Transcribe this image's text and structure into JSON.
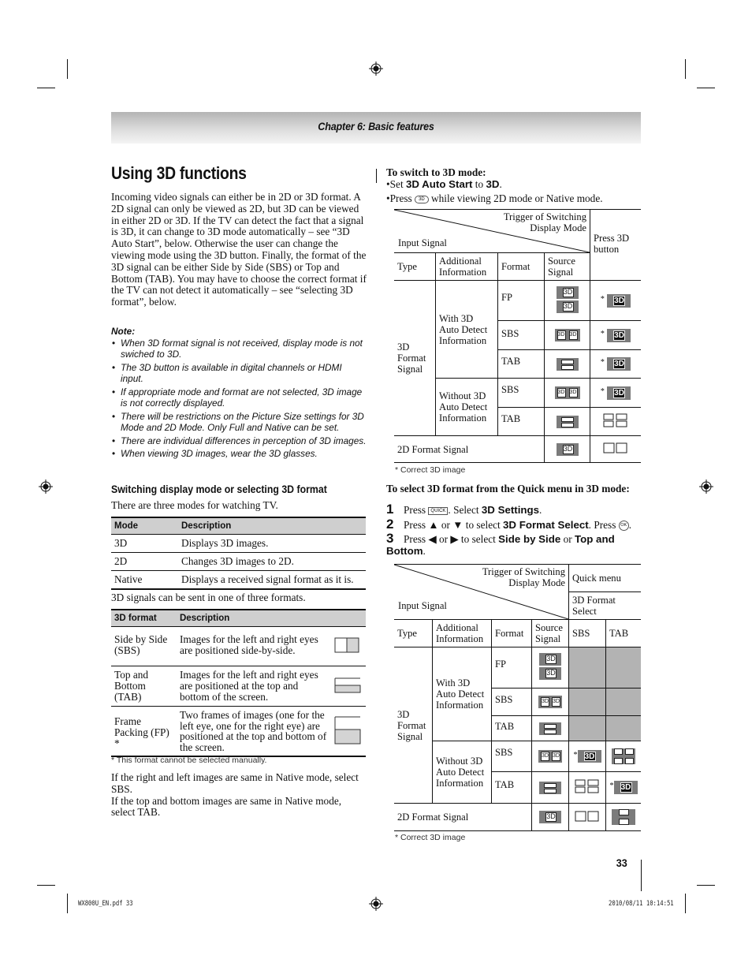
{
  "header": {
    "chapter": "Chapter 6: Basic features"
  },
  "title": "Using 3D functions",
  "intro": "Incoming video signals can either be in 2D or 3D format. A 2D signal can only be viewed as 2D, but 3D can be viewed in either 2D or 3D. If the TV can detect the fact that a signal is 3D, it can change to 3D mode automatically – see “3D Auto Start”, below. Otherwise the user can change the viewing mode using the 3D button. Finally, the format of the 3D signal can be either Side by Side (SBS) or Top and Bottom (TAB). You may have to choose the correct format if the TV can not detect it automatically – see “selecting 3D format”, below.",
  "note": {
    "title": "Note:",
    "items": [
      "When 3D format signal is not received, display mode is not swiched to 3D.",
      "The 3D button is available in digital channels or HDMI input.",
      "If appropriate mode and format are not selected, 3D image is not correctly displayed.",
      "There will be restrictions on the Picture Size settings for 3D Mode and 2D Mode. Only Full and Native can be set.",
      "There are individual differences in perception of 3D images.",
      "When viewing 3D images, wear the 3D glasses."
    ]
  },
  "section": {
    "heading": "Switching display mode or selecting 3D format",
    "modes_intro": "There are three modes for watching TV.",
    "modes_table": {
      "headers": [
        "Mode",
        "Description"
      ],
      "rows": [
        [
          "3D",
          "Displays 3D images."
        ],
        [
          "2D",
          "Changes 3D images to 2D."
        ],
        [
          "Native",
          "Displays a received signal format as it is."
        ]
      ]
    },
    "formats_intro": "3D signals can be sent in one of three formats.",
    "formats_table": {
      "headers": [
        "3D format",
        "Description"
      ],
      "rows": [
        {
          "format": "Side by Side (SBS)",
          "description": "Images for the left and right eyes are positioned side-by-side.",
          "diagram": "side-by-side-icon"
        },
        {
          "format": "Top and Bottom (TAB)",
          "description": "Images for the left and right eyes are positioned at the top and bottom of the screen.",
          "diagram": "top-bottom-icon"
        },
        {
          "format": "Frame Packing (FP) *",
          "description": "Two frames of images (one for the left eye, one for the right eye) are positioned at the top and bottom of the screen.",
          "diagram": "frame-packing-icon"
        }
      ]
    },
    "formats_footnote": "* This format cannot be selected manually.",
    "native_text_1": "If the right and left images are same in Native mode, select SBS.",
    "native_text_2": "If the top and bottom images are same in Native mode, select TAB."
  },
  "switch": {
    "heading": "To switch to 3D mode:",
    "bullet1": {
      "pre": "Set ",
      "b1": "3D Auto Start",
      "mid": " to ",
      "b2": "3D",
      "post": "."
    },
    "bullet2": {
      "pre": "Press ",
      "button": "3D",
      "post": " while viewing 2D mode or Native mode."
    },
    "table1": {
      "trigger": "Trigger of Switching Display Mode",
      "input_signal": "Input Signal",
      "press_3d": "Press 3D button",
      "col_headers": [
        "Type",
        "Additional Information",
        "Format",
        "Source Signal"
      ],
      "type_3d": "3D Format Signal",
      "with_auto": "With 3D Auto Detect Information",
      "without_auto": "Without 3D Auto Detect Information",
      "formats": [
        "FP",
        "SBS",
        "TAB",
        "SBS",
        "TAB"
      ],
      "row_2d": "2D Format Signal",
      "star": "*",
      "footnote": "* Correct 3D image"
    }
  },
  "quick": {
    "heading": "To select 3D format from the Quick menu in 3D mode:",
    "steps": [
      {
        "num": "1",
        "pre": "Press ",
        "button": "QUICK",
        "mid": ". Select ",
        "b1": "3D Settings",
        "post": "."
      },
      {
        "num": "2",
        "pre": "Press ▲ or ▼ to select ",
        "b1": "3D Format Select",
        "mid": ". Press ",
        "button": "OK",
        "post": "."
      },
      {
        "num": "3",
        "pre": "Press ◀ or ▶ to select ",
        "b1": "Side by Side",
        "mid": " or ",
        "b2": "Top and Bottom",
        "post": "."
      }
    ],
    "table2": {
      "trigger": "Trigger of Switching Display Mode",
      "input_signal": "Input Signal",
      "quick_menu": "Quick menu",
      "format_select": "3D Format Select",
      "col_headers": [
        "Type",
        "Additional Information",
        "Format",
        "Source Signal",
        "SBS",
        "TAB"
      ],
      "type_3d": "3D Format Signal",
      "with_auto": "With 3D Auto Detect Information",
      "without_auto": "Without 3D Auto Detect Information",
      "formats": [
        "FP",
        "SBS",
        "TAB",
        "SBS",
        "TAB"
      ],
      "row_2d": "2D Format Signal",
      "star": "*",
      "footnote": "* Correct 3D image"
    }
  },
  "icon_label": "3D",
  "footer": {
    "page_number": "33",
    "slug_file": "WX800U_EN.pdf   33",
    "slug_date": "2010/08/11    10:14:51"
  }
}
